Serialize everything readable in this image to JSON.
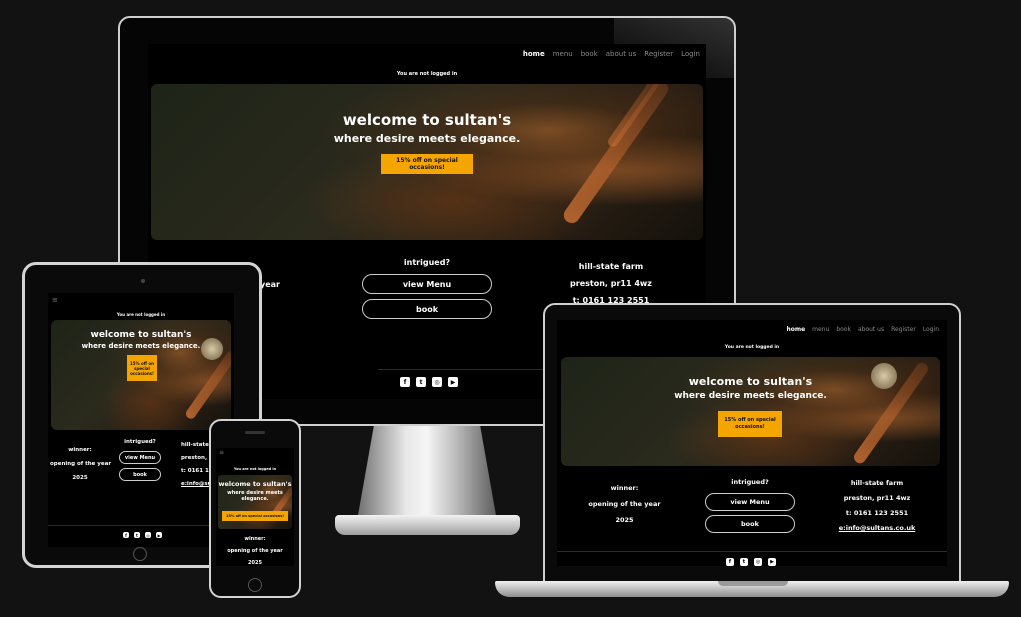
{
  "nav": {
    "items": [
      "home",
      "menu",
      "book",
      "about us",
      "Register",
      "Login"
    ],
    "active": "home"
  },
  "auth_notice": "You are not logged in",
  "hero": {
    "title": "welcome to sultan's",
    "subtitle": "where desire meets elegance.",
    "promo": "15% off on special occasions!"
  },
  "award": {
    "line1": "winner:",
    "line2": "opening of the year",
    "line3": "2025"
  },
  "cta": {
    "heading": "intrigued?",
    "menu_button": "view Menu",
    "book_button": "book"
  },
  "contact": {
    "name": "hill-state farm",
    "address": "preston, pr11 4wz",
    "phone": "t: 0161 123 2551",
    "email": "e:info@sultans.co.uk"
  },
  "social": [
    "f",
    "t",
    "◎",
    "▶"
  ],
  "colors": {
    "accent": "#f5a500",
    "background": "#000000",
    "page": "#121212"
  }
}
